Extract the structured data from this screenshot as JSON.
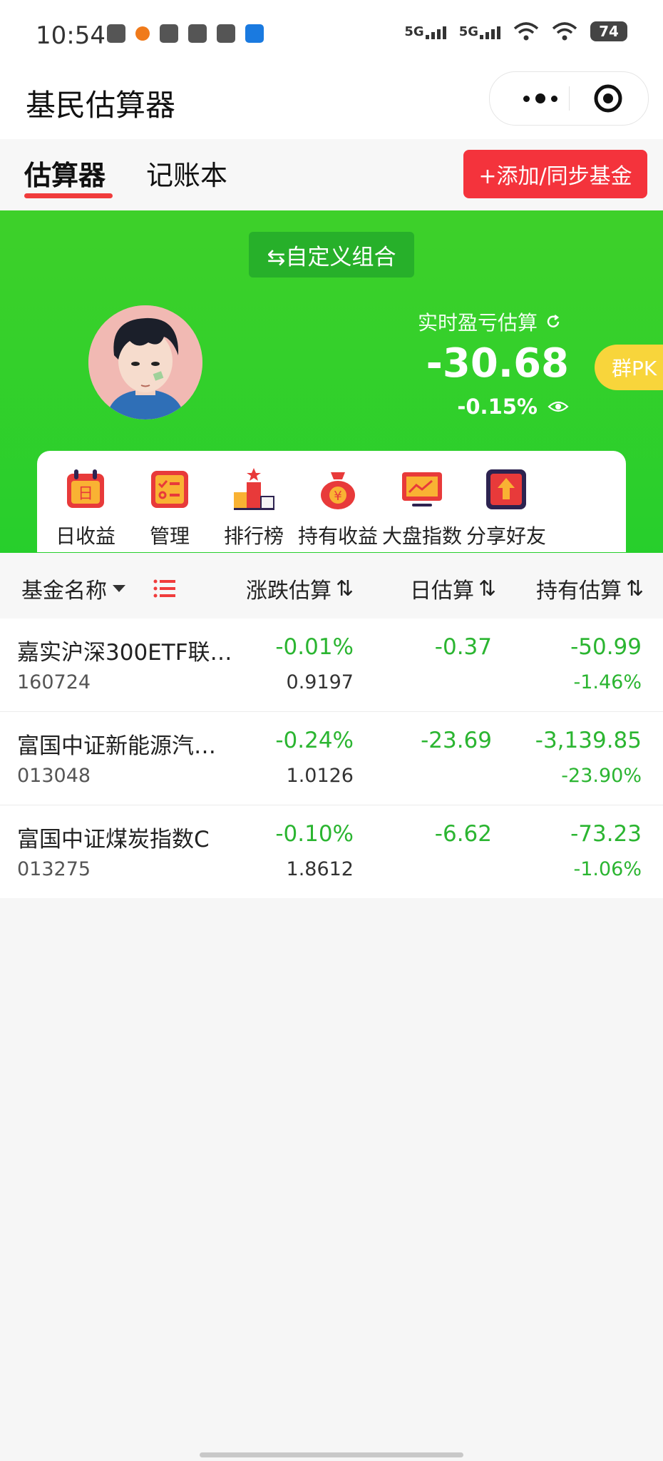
{
  "status_bar": {
    "time": "10:54",
    "network1": "5G",
    "network2": "5G",
    "battery": "74"
  },
  "app": {
    "title": "基民估算器"
  },
  "tabs": [
    {
      "label": "估算器",
      "active": true
    },
    {
      "label": "记账本",
      "active": false
    }
  ],
  "add_button": {
    "label": "+添加/同步基金"
  },
  "banner": {
    "combo_label": "⇆自定义组合",
    "estimate_label": "实时盈亏估算",
    "estimate_value": "-30.68",
    "estimate_percent": "-0.15%",
    "pk_label": "群PK",
    "bg_color": "#2fd22c"
  },
  "menu": [
    {
      "label": "日收益",
      "icon": "calendar-icon"
    },
    {
      "label": "管理",
      "icon": "checklist-icon"
    },
    {
      "label": "排行榜",
      "icon": "podium-icon"
    },
    {
      "label": "持有收益",
      "icon": "moneybag-icon"
    },
    {
      "label": "大盘指数",
      "icon": "monitor-chart-icon"
    },
    {
      "label": "分享好友",
      "icon": "share-icon"
    }
  ],
  "table": {
    "headers": {
      "name": "基金名称",
      "change": "涨跌估算",
      "day": "日估算",
      "hold": "持有估算",
      "sort_glyph": "⇅"
    },
    "rows": [
      {
        "name": "嘉实沪深300ETF联…",
        "code": "160724",
        "change": "-0.01%",
        "nav": "0.9197",
        "day": "-0.37",
        "hold": "-50.99",
        "hold_pct": "-1.46%"
      },
      {
        "name": "富国中证新能源汽…",
        "code": "013048",
        "change": "-0.24%",
        "nav": "1.0126",
        "day": "-23.69",
        "hold": "-3,139.85",
        "hold_pct": "-23.90%"
      },
      {
        "name": "富国中证煤炭指数C",
        "code": "013275",
        "change": "-0.10%",
        "nav": "1.8612",
        "day": "-6.62",
        "hold": "-73.23",
        "hold_pct": "-1.06%"
      }
    ]
  },
  "colors": {
    "accent_red": "#f4333c",
    "down_green": "#2bb531",
    "pk_yellow": "#f8d53b"
  }
}
